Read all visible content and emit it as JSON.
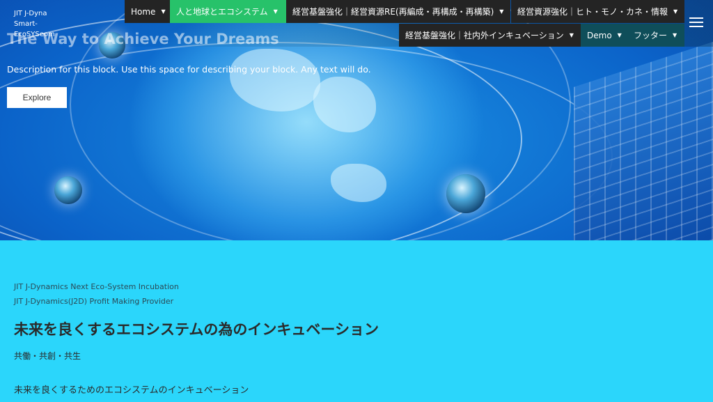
{
  "site": {
    "logo_text": "JIT J-Dyna Smart-EcoSYSeom"
  },
  "nav": {
    "items": [
      {
        "label": "Home"
      },
      {
        "label": "人と地球とエコシステム"
      },
      {
        "label": "経営基盤強化｜経営資源RE(再編成・再構成・再構築)"
      },
      {
        "label": "経営資源強化｜ヒト・モノ・カネ・情報"
      },
      {
        "label": "経営基盤強化｜社内外インキュベーション"
      },
      {
        "label": "Demo"
      },
      {
        "label": "フッター"
      }
    ],
    "caret": "▼"
  },
  "hero": {
    "title": "The Way to Achieve Your Dreams",
    "description": "Description for this block. Use this space for describing your block. Any text will do.",
    "button_label": "Explore"
  },
  "content": {
    "subtitle_1": "JIT J-Dynamics Next Eco-System Incubation",
    "subtitle_2": "JIT J-Dynamics(J2D) Profit Making Provider",
    "heading": "未来を良くするエコシステムの為のインキュベーション",
    "tagline": "共働・共創・共生",
    "body": "未来を良くするためのエコシステムのインキュベーション"
  },
  "colors": {
    "content_bg": "#2bd6fb",
    "nav_dark": "#242424",
    "nav_active": "#27c26a",
    "nav_teal": "#0f4e5a"
  }
}
